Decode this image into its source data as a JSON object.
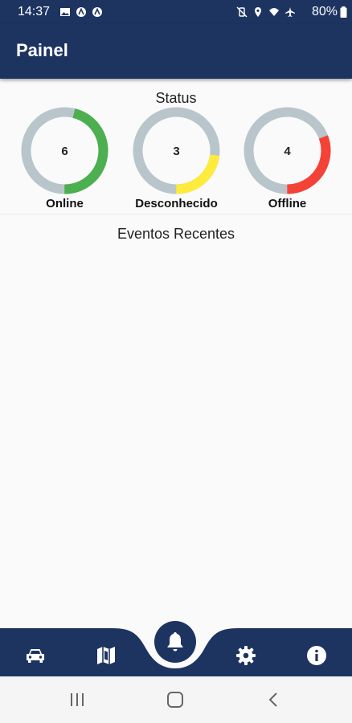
{
  "status_bar": {
    "time": "14:37",
    "battery": "80%",
    "left_icons": [
      "image-icon",
      "app-notification-icon",
      "app-notification-icon"
    ],
    "right_icons": [
      "mute-vibrate-icon",
      "location-icon",
      "wifi-icon",
      "airplane-icon",
      "battery-icon"
    ]
  },
  "app_bar": {
    "title": "Painel"
  },
  "status_section": {
    "title": "Status",
    "items": [
      {
        "label": "Online",
        "count": "6",
        "value": 6,
        "color": "#4caf50"
      },
      {
        "label": "Desconhecido",
        "count": "3",
        "value": 3,
        "color": "#ffeb3b"
      },
      {
        "label": "Offline",
        "count": "4",
        "value": 4,
        "color": "#f44336"
      }
    ],
    "ring_background_color": "#b8c6cc"
  },
  "events_section": {
    "title": "Eventos Recentes"
  },
  "bottom_nav": {
    "items": [
      "car-icon",
      "map-icon",
      "bell-icon",
      "settings-icon",
      "info-icon"
    ],
    "active": "bell-icon",
    "color": "#1d3461"
  },
  "system_nav": {
    "items": [
      "recent-apps-icon",
      "home-icon",
      "back-icon"
    ]
  }
}
